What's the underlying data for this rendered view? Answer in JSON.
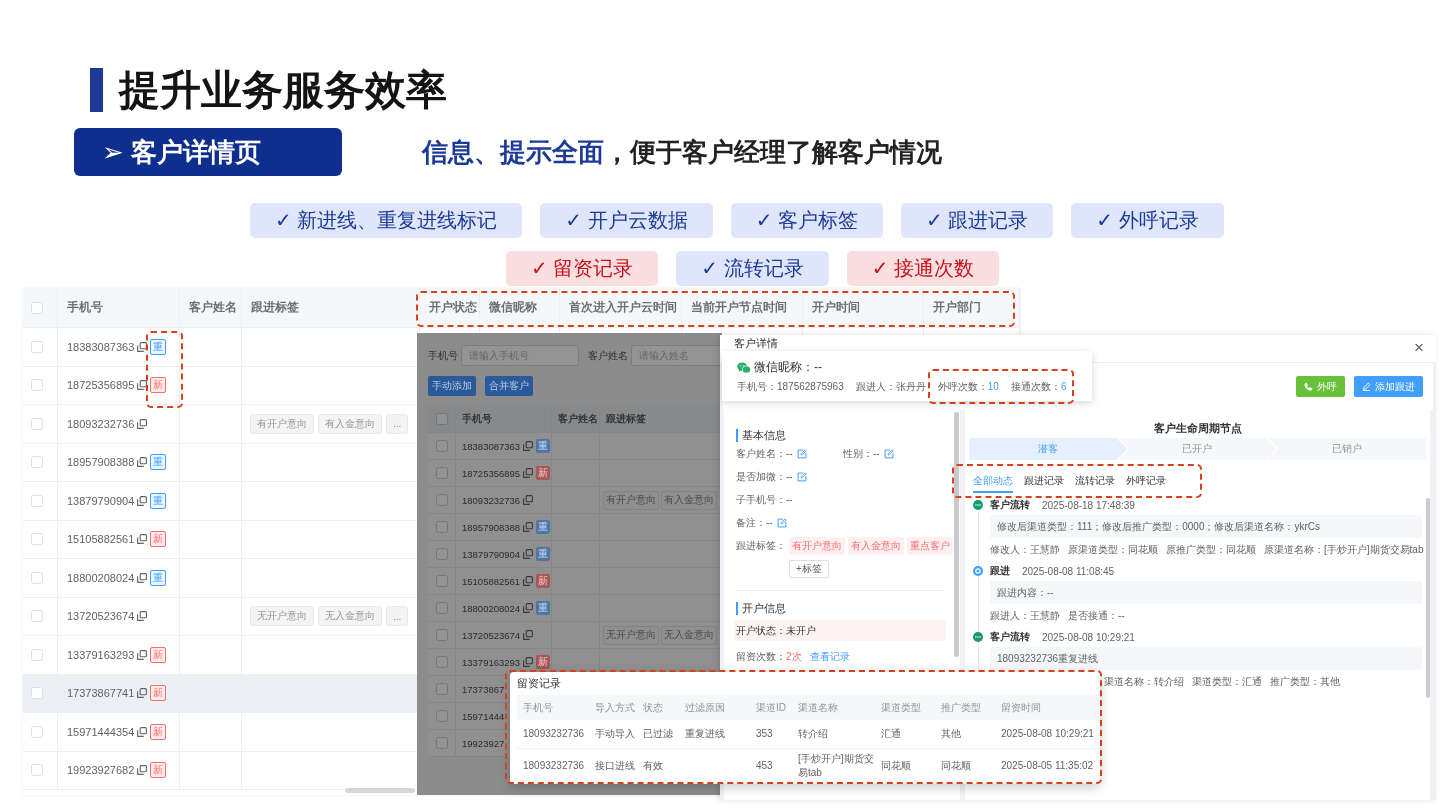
{
  "title": "提升业务服务效率",
  "section": "➢ 客户详情页",
  "subtitle": {
    "highlight": "信息、提示全面",
    "rest": "，便于客户经理了解客户情况"
  },
  "feature_rows": [
    [
      {
        "label": "✓ 新进线、重复进线标记",
        "color": "#1c3a96"
      },
      {
        "label": "✓ 开户云数据",
        "color": "#1c3a96"
      },
      {
        "label": "✓ 客户标签",
        "color": "#1c3a96"
      },
      {
        "label": "✓ 跟进记录",
        "color": "#1c3a96"
      },
      {
        "label": "✓ 外呼记录",
        "color": "#1c3a96"
      }
    ],
    [
      {
        "label": "✓ 留资记录",
        "color": "#c8121a"
      },
      {
        "label": "✓ 流转记录",
        "color": "#1c3a96"
      },
      {
        "label": "✓ 接通次数",
        "color": "#c8121a"
      }
    ]
  ],
  "customer_table": {
    "select_all_checked": false,
    "columns": [
      "手机号",
      "客户姓名",
      "跟进标签",
      "开户状态",
      "微信昵称",
      "首次进入开户云时间",
      "当前开户节点时间",
      "开户时间",
      "开户部门"
    ],
    "rows": [
      {
        "phone": "18383087363",
        "flag": {
          "label": "重",
          "color": "#409eff"
        },
        "checked": false,
        "highlighted": false
      },
      {
        "phone": "18725356895",
        "flag": {
          "label": "新",
          "color": "#f56c6c"
        },
        "checked": false,
        "highlighted": false
      },
      {
        "phone": "18093232736",
        "tags": [
          "有开户意向",
          "有入金意向"
        ],
        "more": "...",
        "checked": false,
        "highlighted": false
      },
      {
        "phone": "18957908388",
        "flag": {
          "label": "重",
          "color": "#409eff"
        },
        "checked": false,
        "highlighted": false
      },
      {
        "phone": "13879790904",
        "flag": {
          "label": "重",
          "color": "#409eff"
        },
        "checked": false,
        "highlighted": false
      },
      {
        "phone": "15105882561",
        "flag": {
          "label": "新",
          "color": "#f56c6c"
        },
        "checked": false,
        "highlighted": false
      },
      {
        "phone": "18800208024",
        "flag": {
          "label": "重",
          "color": "#409eff"
        },
        "checked": false,
        "highlighted": false
      },
      {
        "phone": "13720523674",
        "tags": [
          "无开户意向",
          "无入金意向"
        ],
        "more": "...",
        "checked": false,
        "highlighted": false
      },
      {
        "phone": "13379163293",
        "flag": {
          "label": "新",
          "color": "#f56c6c"
        },
        "checked": false,
        "highlighted": false
      },
      {
        "phone": "17373867741",
        "flag": {
          "label": "新",
          "color": "#f56c6c"
        },
        "checked": false,
        "highlighted": true
      },
      {
        "phone": "15971444354",
        "flag": {
          "label": "新",
          "color": "#f56c6c"
        },
        "checked": false,
        "highlighted": false
      },
      {
        "phone": "19923927682",
        "flag": {
          "label": "新",
          "color": "#f56c6c"
        },
        "checked": false,
        "highlighted": false
      }
    ]
  },
  "background_page": {
    "filters": [
      {
        "label": "手机号",
        "placeholder": "请输入手机号"
      },
      {
        "label": "客户姓名",
        "placeholder": "请输入姓名"
      }
    ],
    "buttons": [
      "手动添加",
      "合并客户"
    ],
    "select_all_checked": false,
    "columns": [
      "手机号",
      "客户姓名",
      "跟进标签"
    ],
    "rows": [
      {
        "phone": "18383087363",
        "flag": {
          "label": "重",
          "color": "#4f74a6"
        },
        "checked": false
      },
      {
        "phone": "18725356895",
        "flag": {
          "label": "新",
          "color": "#a85656"
        },
        "checked": false
      },
      {
        "phone": "18093232736",
        "tags": [
          "有开户意向",
          "有入金意向"
        ],
        "checked": false
      },
      {
        "phone": "18957908388",
        "flag": {
          "label": "重",
          "color": "#4f74a6"
        },
        "checked": false
      },
      {
        "phone": "13879790904",
        "flag": {
          "label": "重",
          "color": "#4f74a6"
        },
        "checked": false
      },
      {
        "phone": "15105882561",
        "flag": {
          "label": "新",
          "color": "#a85656"
        },
        "checked": false
      },
      {
        "phone": "18800208024",
        "flag": {
          "label": "重",
          "color": "#4f74a6"
        },
        "checked": false
      },
      {
        "phone": "13720523674",
        "tags": [
          "无开户意向",
          "无入金意向"
        ],
        "checked": false
      },
      {
        "phone": "13379163293",
        "flag": {
          "label": "新",
          "color": "#a85656"
        },
        "checked": false
      },
      {
        "phone": "17373867",
        "checked": false
      },
      {
        "phone": "15971444",
        "checked": false
      },
      {
        "phone": "19923927",
        "checked": false
      }
    ]
  },
  "customer_detail": {
    "title": "客户详情",
    "close": "×",
    "summary": {
      "nickname": "微信昵称：--",
      "phone": "手机号：187562875963",
      "follower": "跟进人：张丹丹",
      "stats": [
        {
          "label": "外呼次数：",
          "value": "10"
        },
        {
          "label": "接通次数：",
          "value": "6"
        }
      ]
    },
    "actions": [
      {
        "label": "外呼",
        "kind": "call"
      },
      {
        "label": "添加跟进",
        "kind": "follow"
      }
    ],
    "basic_info": {
      "heading": "基本信息",
      "field_rows": [
        [
          {
            "text": "客户姓名：--",
            "editable": true
          },
          {
            "text": "性别：--",
            "editable": true
          }
        ],
        [
          {
            "text": "是否加微：--",
            "editable": true
          }
        ],
        [
          {
            "text": "子手机号：--",
            "editable": false
          }
        ],
        [
          {
            "text": "备注：--",
            "editable": true
          }
        ]
      ],
      "tags_label": "跟进标签：",
      "tags": [
        "有开户意向",
        "有入金意向",
        "重点客户"
      ],
      "add_tag": "+标签"
    },
    "account_info": {
      "heading": "开户信息",
      "status": "开户状态：未开户",
      "lead_label": "留资次数：",
      "lead_count": "2次",
      "view_link": "查看记录"
    },
    "lifecycle": {
      "heading": "客户生命周期节点",
      "steps": [
        {
          "label": "潜客",
          "selected": true
        },
        {
          "label": "已开户",
          "selected": false
        },
        {
          "label": "已销户",
          "selected": false
        }
      ]
    },
    "tabs": [
      {
        "label": "全部动态",
        "selected": true
      },
      {
        "label": "跟进记录",
        "selected": false
      },
      {
        "label": "流转记录",
        "selected": false
      },
      {
        "label": "外呼记录",
        "selected": false
      }
    ],
    "timeline": [
      {
        "kind": "transfer",
        "title": "客户流转",
        "time": "2025-08-18 17:48:39",
        "content": "修改后渠道类型：111；修改后推广类型：0000；修改后渠道名称：ykrCs",
        "meta": [
          "修改人：王慧静",
          "原渠道类型：同花顺",
          "原推广类型：同花顺",
          "原渠道名称：[手炒开户]期货交易tab"
        ]
      },
      {
        "kind": "follow",
        "title": "跟进",
        "time": "2025-08-08 11:08:45",
        "content": "跟进内容：--",
        "meta": [
          "跟进人：王慧静",
          "是否接通：--"
        ]
      },
      {
        "kind": "transfer",
        "title": "客户流转",
        "time": "2025-08-08 10:29:21",
        "content": "18093232736重复进线",
        "meta": [
          "渠道名称：转介绍",
          "渠道类型：汇通",
          "推广类型：其他"
        ]
      }
    ]
  },
  "lead_records": {
    "title": "留资记录",
    "columns": [
      "手机号",
      "导入方式",
      "状态",
      "过滤原因",
      "渠道ID",
      "渠道名称",
      "渠道类型",
      "推广类型",
      "留资时间"
    ],
    "rows": [
      {
        "phone": "18093232736",
        "import_method": "手动导入",
        "status": "已过滤",
        "filter_reason": "重复进线",
        "channel_id": "353",
        "channel_name": "转介绍",
        "channel_type": "汇通",
        "promotion_type": "其他",
        "time": "2025-08-08 10:29:21"
      },
      {
        "phone": "18093232736",
        "import_method": "接口进线",
        "status": "有效",
        "channel_id": "453",
        "channel_name": "[手炒开户]期货交易tab",
        "channel_type": "同花顺",
        "promotion_type": "同花顺",
        "time": "2025-08-05 11:35:02"
      }
    ]
  }
}
